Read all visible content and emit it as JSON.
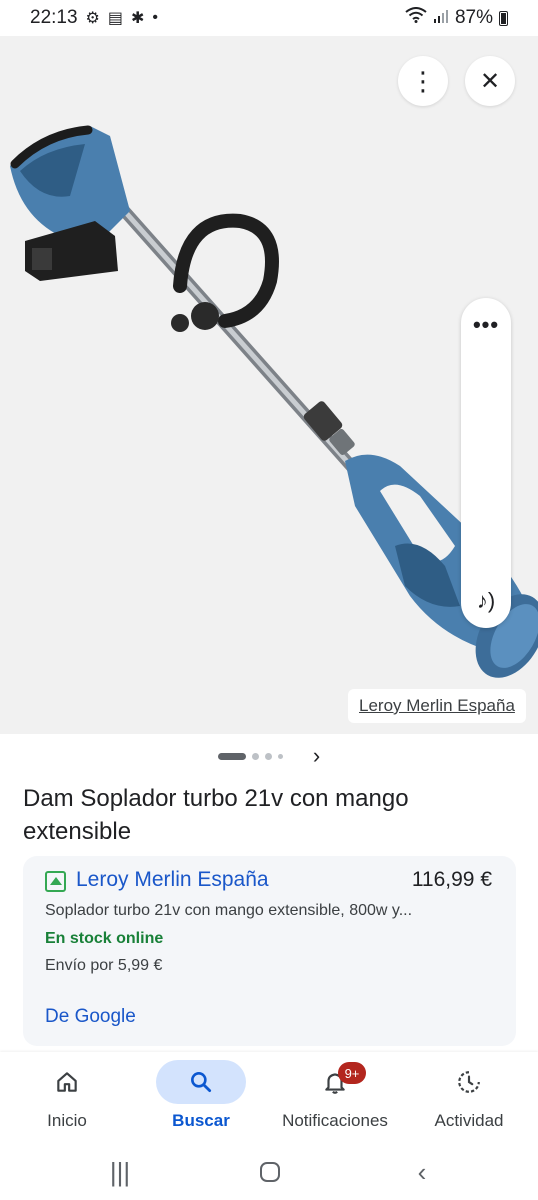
{
  "status_bar": {
    "time": "22:13",
    "icons": [
      "gear-icon",
      "calendar-icon",
      "caixabank-icon",
      "dot-icon"
    ],
    "battery_percent": "87%",
    "network": [
      "wifi-icon",
      "signal-icon",
      "battery-icon"
    ]
  },
  "image_viewer": {
    "product_image": "cordless-leaf-blower-with-telescopic-handle",
    "source_label": "Leroy Merlin España",
    "pager": {
      "total": 4,
      "active": 1
    }
  },
  "product": {
    "title": "Dam Soplador turbo 21v con mango extensible"
  },
  "offer": {
    "merchant": "Leroy Merlin España",
    "price": "116,99 €",
    "description": "Soplador turbo 21v con mango extensible, 800w y...",
    "stock": "En stock online",
    "shipping": "Envío por 5,99 €",
    "source_link": "De Google"
  },
  "bottom_nav": {
    "items": [
      {
        "label": "Inicio",
        "icon": "home-icon",
        "active": false
      },
      {
        "label": "Buscar",
        "icon": "search-icon",
        "active": true
      },
      {
        "label": "Notificaciones",
        "icon": "bell-icon",
        "active": false,
        "badge": "9+"
      },
      {
        "label": "Actividad",
        "icon": "activity-icon",
        "active": false
      }
    ]
  },
  "colors": {
    "link": "#1a57c9",
    "in_stock": "#188038",
    "active_nav_bg": "#d3e3fd",
    "badge": "#b3261e",
    "product_blue": "#4a7fae"
  }
}
